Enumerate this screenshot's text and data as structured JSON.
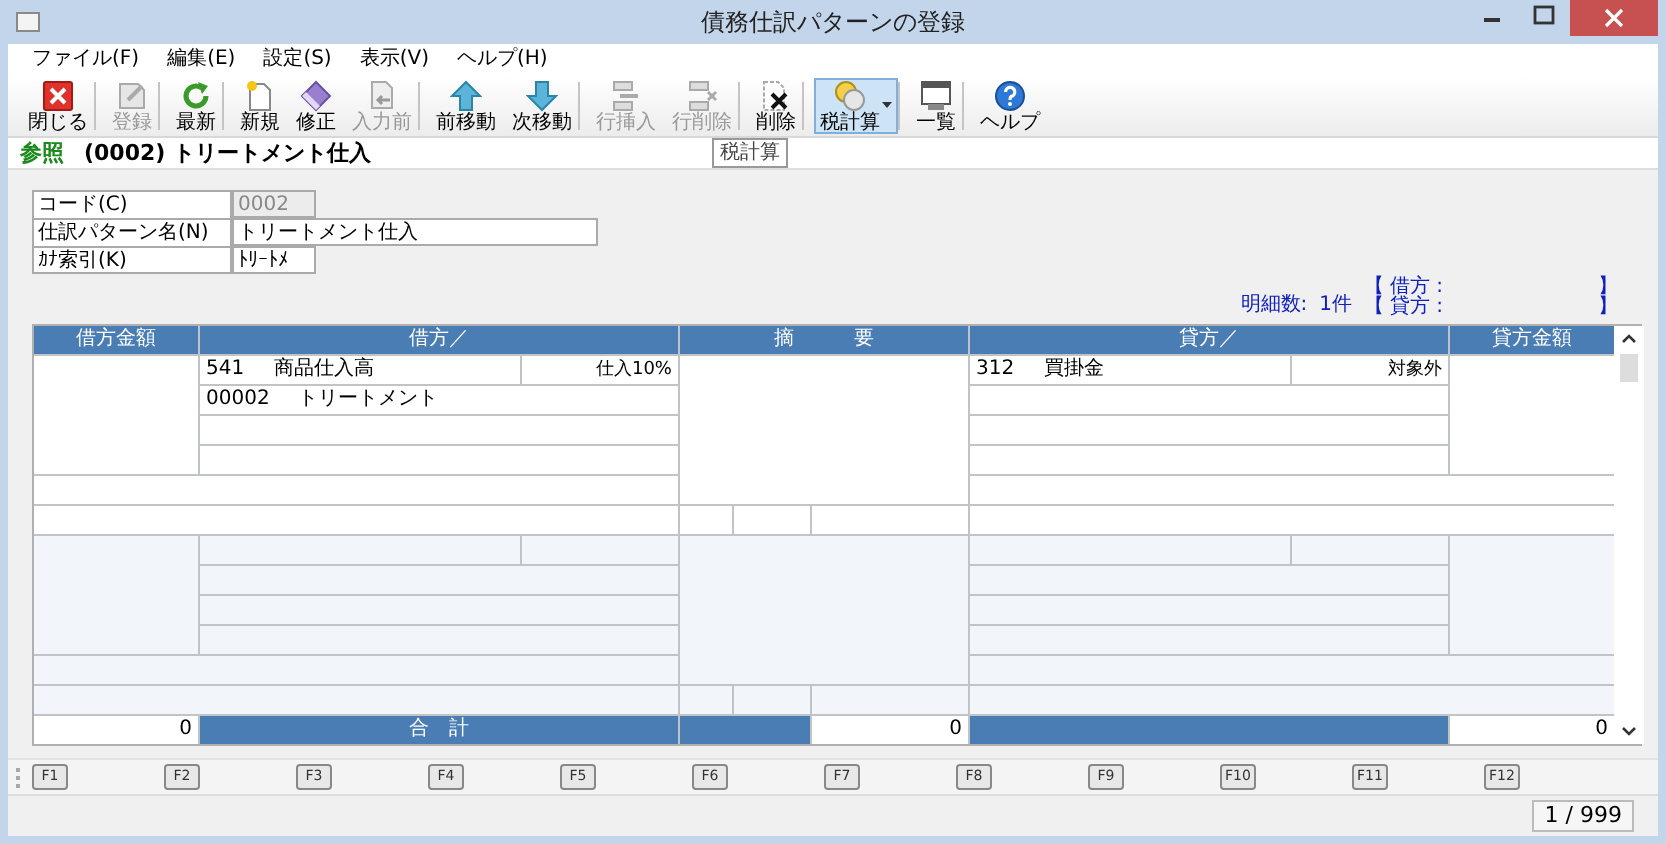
{
  "window": {
    "title": "債務仕訳パターンの登録"
  },
  "menu": [
    "ファイル(F)",
    "編集(E)",
    "設定(S)",
    "表示(V)",
    "ヘルプ(H)"
  ],
  "toolbar": [
    {
      "label": "閉じる",
      "kind": "close",
      "disabled": false,
      "pressed": false,
      "dropdown": false,
      "separator_after": true
    },
    {
      "label": "登録",
      "kind": "save",
      "disabled": true,
      "pressed": false,
      "dropdown": false,
      "separator_after": true
    },
    {
      "label": "最新",
      "kind": "refresh",
      "disabled": false,
      "pressed": false,
      "dropdown": false,
      "separator_after": true
    },
    {
      "label": "新規",
      "kind": "new",
      "disabled": false,
      "pressed": false,
      "dropdown": false,
      "separator_after": false
    },
    {
      "label": "修正",
      "kind": "edit",
      "disabled": false,
      "pressed": false,
      "dropdown": false,
      "separator_after": false
    },
    {
      "label": "入力前",
      "kind": "previnput",
      "disabled": true,
      "pressed": false,
      "dropdown": false,
      "separator_after": true
    },
    {
      "label": "前移動",
      "kind": "up",
      "disabled": false,
      "pressed": false,
      "dropdown": false,
      "separator_after": false
    },
    {
      "label": "次移動",
      "kind": "down",
      "disabled": false,
      "pressed": false,
      "dropdown": false,
      "separator_after": true
    },
    {
      "label": "行挿入",
      "kind": "insertrow",
      "disabled": true,
      "pressed": false,
      "dropdown": false,
      "separator_after": false
    },
    {
      "label": "行削除",
      "kind": "deleterow",
      "disabled": true,
      "pressed": false,
      "dropdown": false,
      "separator_after": true
    },
    {
      "label": "削除",
      "kind": "delete",
      "disabled": false,
      "pressed": false,
      "dropdown": false,
      "separator_after": true
    },
    {
      "label": "税計算",
      "kind": "tax",
      "disabled": false,
      "pressed": true,
      "dropdown": true,
      "separator_after": true
    },
    {
      "label": "一覧",
      "kind": "list",
      "disabled": false,
      "pressed": false,
      "dropdown": false,
      "separator_after": true
    },
    {
      "label": "ヘルプ",
      "kind": "help",
      "disabled": false,
      "pressed": false,
      "dropdown": false,
      "separator_after": false
    }
  ],
  "tooltip": "税計算",
  "mode": {
    "label": "参照",
    "title": "(0002) トリートメント仕入"
  },
  "form": [
    {
      "label": "コード(C)",
      "value": "0002",
      "disabled": true,
      "kind": "short"
    },
    {
      "label": "仕訳パターン名(N)",
      "value": "トリートメント仕入",
      "disabled": false,
      "kind": "long"
    },
    {
      "label": "ｶﾅ索引(K)",
      "value": "ﾄﾘｰﾄﾒ",
      "disabled": false,
      "kind": "short"
    }
  ],
  "info": {
    "count_label": "明細数:",
    "count": "1件",
    "sides": [
      {
        "open": "【",
        "label": "借方 :",
        "close": "】"
      },
      {
        "open": "【",
        "label": "貸方 :",
        "close": "】"
      }
    ]
  },
  "table": {
    "columns": [
      "借方金額",
      "借方／",
      "摘　　　要",
      "貸方／",
      "貸方金額"
    ],
    "entries": [
      {
        "debit": {
          "code": "541",
          "name": "商品仕入高",
          "tax": "仕入10%",
          "sub_code": "00002",
          "sub_name": "トリートメント"
        },
        "credit": {
          "code": "312",
          "name": "買掛金",
          "tax": "対象外"
        }
      }
    ],
    "totals": {
      "debit_amount": "0",
      "label": "合　計",
      "summary_amount": "0",
      "credit_amount": "0"
    }
  },
  "function_keys": [
    "F1",
    "F2",
    "F3",
    "F4",
    "F5",
    "F6",
    "F7",
    "F8",
    "F9",
    "F10",
    "F11",
    "F12"
  ],
  "status_bar": {
    "page": "1 / 999"
  }
}
